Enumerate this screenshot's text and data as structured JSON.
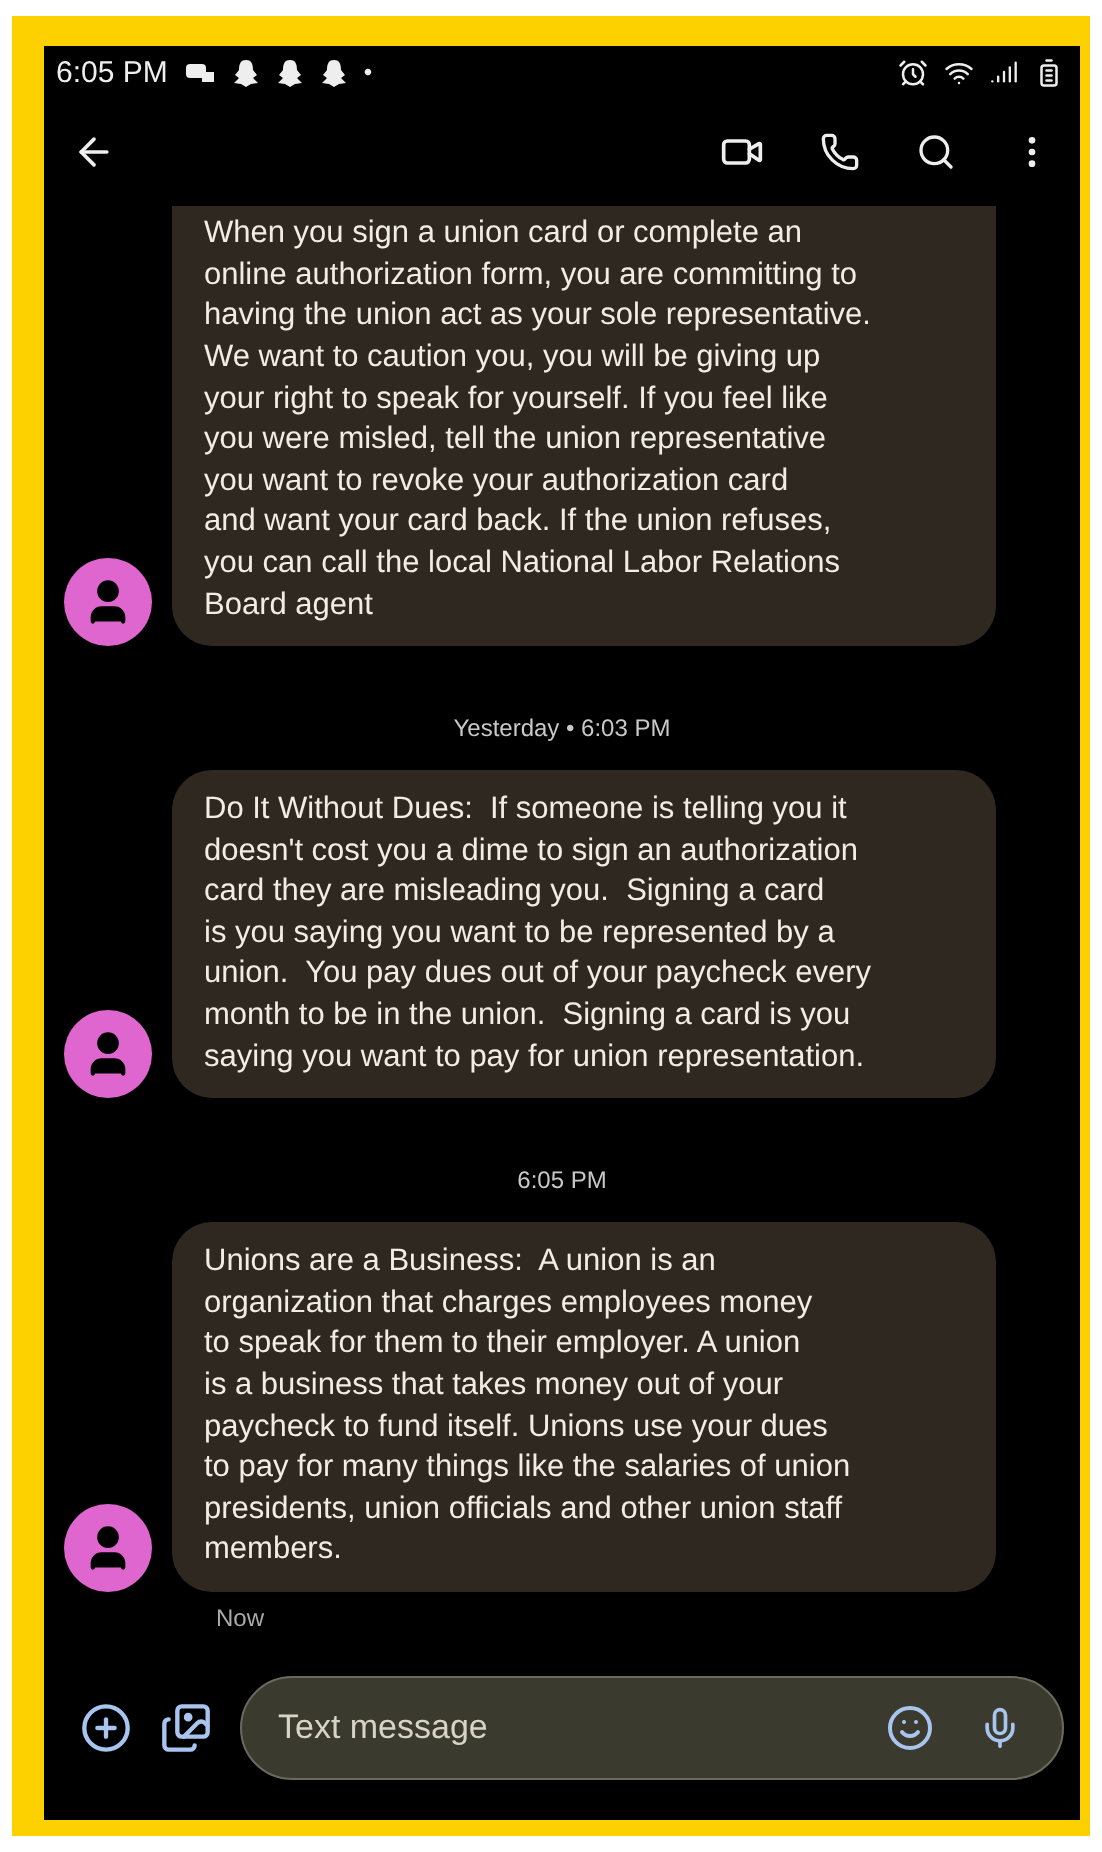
{
  "status_bar": {
    "time": "6:05 PM",
    "dot": "•"
  },
  "thread": [
    {
      "kind": "message",
      "text": "When you sign a union card or complete an\nonline authorization form, you are committing to\nhaving the union act as your sole representative.\nWe want to caution you, you will be giving up\nyour right to speak for yourself. If you feel like\nyou were misled, tell the union representative\nyou want to revoke your authorization card\nand want your card back. If the union refuses,\nyou can call the local National Labor Relations\nBoard agent"
    },
    {
      "kind": "timestamp",
      "text": "Yesterday • 6:03 PM"
    },
    {
      "kind": "message",
      "text": "Do It Without Dues:  If someone is telling you it\ndoesn't cost you a dime to sign an authorization\ncard they are misleading you.  Signing a card\nis you saying you want to be represented by a\nunion.  You pay dues out of your paycheck every\nmonth to be in the union.  Signing a card is you\nsaying you want to pay for union representation."
    },
    {
      "kind": "timestamp",
      "text": "6:05 PM"
    },
    {
      "kind": "message",
      "text": "Unions are a Business:  A union is an\norganization that charges employees money\nto speak for them to their employer. A union\nis a business that takes money out of your\npaycheck to fund itself. Unions use your dues\nto pay for many things like the salaries of union\npresidents, union officials and other union staff\nmembers."
    },
    {
      "kind": "status",
      "text": "Now"
    }
  ],
  "composer": {
    "placeholder": "Text message"
  }
}
